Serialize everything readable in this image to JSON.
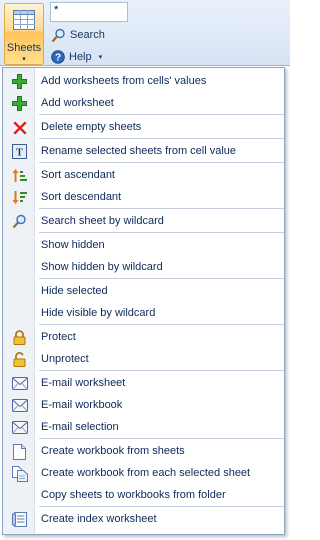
{
  "ribbon": {
    "sheets_label": "Sheets",
    "sheets_arrow": "▾",
    "input_value": "*",
    "search_label": "Search",
    "help_label": "Help",
    "help_arrow": "▾"
  },
  "menu": {
    "items": [
      {
        "label": "Add worksheets from cells' values",
        "icon": "plus-icon"
      },
      {
        "label": "Add worksheet",
        "icon": "plus-icon"
      },
      {
        "label": "Delete empty sheets",
        "icon": "delete-x-icon"
      },
      {
        "label": "Rename selected sheets from cell value",
        "icon": "rename-icon"
      },
      {
        "label": "Sort ascendant",
        "icon": "sort-ascending-icon"
      },
      {
        "label": "Sort descendant",
        "icon": "sort-descending-icon"
      },
      {
        "label": "Search sheet by wildcard",
        "icon": "magnifier-icon"
      },
      {
        "label": "Show hidden",
        "icon": ""
      },
      {
        "label": "Show hidden by wildcard",
        "icon": ""
      },
      {
        "label": "Hide selected",
        "icon": ""
      },
      {
        "label": "Hide visible by wildcard",
        "icon": ""
      },
      {
        "label": "Protect",
        "icon": "lock-icon"
      },
      {
        "label": "Unprotect",
        "icon": "unlock-icon"
      },
      {
        "label": "E-mail worksheet",
        "icon": "envelope-icon"
      },
      {
        "label": "E-mail workbook",
        "icon": "envelope-icon"
      },
      {
        "label": "E-mail selection",
        "icon": "envelope-icon"
      },
      {
        "label": "Create workbook from sheets",
        "icon": "document-icon"
      },
      {
        "label": "Create workbook from each selected sheet",
        "icon": "documents-icon"
      },
      {
        "label": "Copy sheets to workbooks from folder",
        "icon": ""
      },
      {
        "label": "Create index worksheet",
        "icon": "index-sheet-icon"
      }
    ]
  }
}
